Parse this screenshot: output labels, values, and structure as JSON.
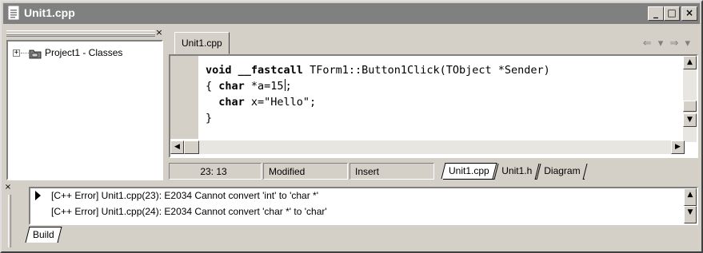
{
  "window": {
    "title": "Unit1.cpp",
    "minimize": "_",
    "maximize": "□",
    "close": "×"
  },
  "tree": {
    "panel_close": "×",
    "expander": "+",
    "project_label": "Project1 - Classes"
  },
  "editor": {
    "file_tab": "Unit1.cpp",
    "nav": {
      "back": "⇐ ▾",
      "forward": "⇒ ▾"
    },
    "code": {
      "l1_kw1": "void",
      "l1_kw2": "__fastcall",
      "l1_rest": " TForm1::Button1Click(TObject *Sender)",
      "l2_open": "{ ",
      "l2_kw": "char",
      "l2_rest_a": " *a=15",
      "l2_rest_b": ";",
      "l3_indent": "  ",
      "l3_kw": "char",
      "l3_rest": " x=\"Hello\";",
      "l4": "}"
    }
  },
  "status": {
    "position": "23: 13",
    "modified": "Modified",
    "mode": "Insert",
    "tabs": [
      "Unit1.cpp",
      "Unit1.h",
      "Diagram"
    ],
    "active_tab": "Unit1.cpp"
  },
  "messages": {
    "close": "×",
    "lines": [
      "[C++ Error] Unit1.cpp(23): E2034 Cannot convert 'int' to 'char *'",
      "[C++ Error] Unit1.cpp(24): E2034 Cannot convert 'char *' to 'char'"
    ],
    "tab": "Build"
  },
  "icons": {
    "title": "document-icon",
    "project": "project-folder-icon"
  },
  "colors": {
    "titlebar_inactive": "#808080",
    "face": "#d4d0c8"
  }
}
